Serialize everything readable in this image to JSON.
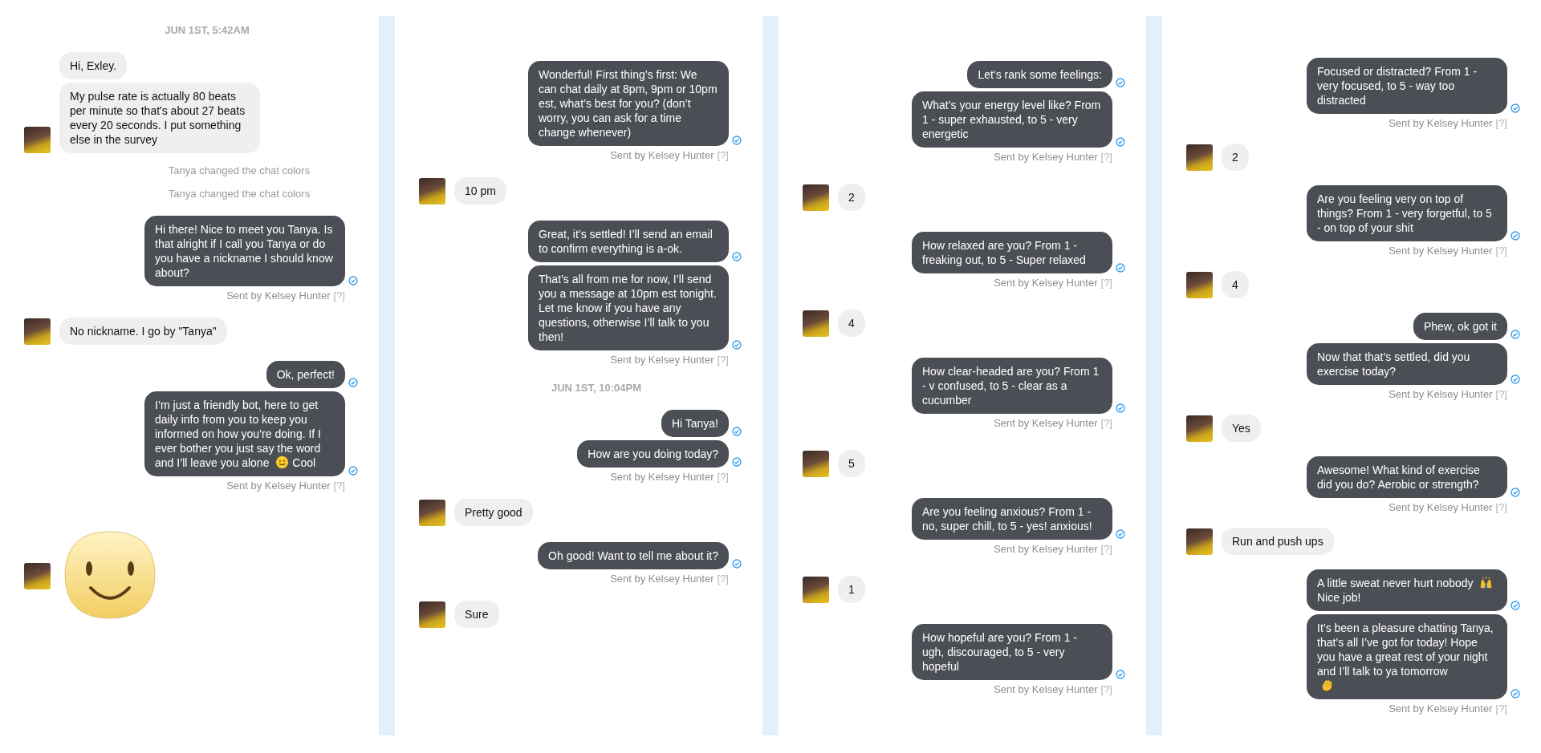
{
  "columns": [
    {
      "items": [
        {
          "kind": "timestamp",
          "text": "JUN 1ST, 5:42AM"
        },
        {
          "kind": "incoming",
          "messages": [
            {
              "text": "Hi, Exley."
            },
            {
              "text": "My pulse rate is actually 80 beats per minute so that's about 27 beats every 20 seconds. I put something else in the survey"
            }
          ]
        },
        {
          "kind": "notice",
          "text": "Tanya changed the chat colors"
        },
        {
          "kind": "notice",
          "text": "Tanya changed the chat colors"
        },
        {
          "kind": "outgoing",
          "messages": [
            {
              "text": "Hi there! Nice to meet you Tanya. Is that alright if I call you Tanya or do you have a nickname I should know about?"
            }
          ],
          "sent_by": "Sent by Kelsey Hunter",
          "help": "[?]"
        },
        {
          "kind": "incoming",
          "messages": [
            {
              "text": "No nickname.   I go by \"Tanya\""
            }
          ]
        },
        {
          "kind": "outgoing",
          "messages": [
            {
              "text": "Ok, perfect!"
            },
            {
              "segments": [
                {
                  "kind": "text",
                  "text": "I’m just a friendly bot, here to get daily info from you to keep you informed on how you’re doing. If I ever bother you just say the word"
                },
                {
                  "kind": "text",
                  "text": "and I’ll leave you alone"
                },
                {
                  "kind": "smiley"
                },
                {
                  "kind": "text",
                  "text": "Cool"
                }
              ]
            }
          ],
          "sent_by": "Sent by Kelsey Hunter",
          "help": "[?]"
        },
        {
          "kind": "sticker"
        }
      ]
    },
    {
      "items": [
        {
          "kind": "outgoing",
          "messages": [
            {
              "text": "Wonderful! First thing’s first: We can chat daily at 8pm, 9pm or 10pm est, what’s best for you? (don’t worry, you can ask for a time change whenever)"
            }
          ],
          "sent_by": "Sent by Kelsey Hunter",
          "help": "[?]"
        },
        {
          "kind": "incoming",
          "messages": [
            {
              "text": "10 pm"
            }
          ]
        },
        {
          "kind": "outgoing",
          "messages": [
            {
              "text": "Great, it’s settled! I’ll send an email to confirm everything is a-ok."
            },
            {
              "text": "That’s all from me for now, I’ll send you a message at 10pm est tonight. Let me know if you have any questions, otherwise I’ll talk to you then!"
            }
          ],
          "sent_by": "Sent by Kelsey Hunter",
          "help": "[?]"
        },
        {
          "kind": "timestamp",
          "text": "JUN 1ST, 10:04PM"
        },
        {
          "kind": "outgoing",
          "messages": [
            {
              "text": "Hi Tanya!"
            },
            {
              "text": "How are you doing today?"
            }
          ],
          "sent_by": "Sent by Kelsey Hunter",
          "help": "[?]"
        },
        {
          "kind": "incoming",
          "messages": [
            {
              "text": "Pretty good"
            }
          ]
        },
        {
          "kind": "outgoing",
          "messages": [
            {
              "text": "Oh good! Want to tell me about it?"
            }
          ],
          "sent_by": "Sent by Kelsey Hunter",
          "help": "[?]"
        },
        {
          "kind": "incoming",
          "messages": [
            {
              "text": "Sure"
            }
          ]
        }
      ]
    },
    {
      "items": [
        {
          "kind": "outgoing",
          "messages": [
            {
              "text": "Let’s rank some feelings:"
            },
            {
              "text": "What’s your energy level like? From 1 - super exhausted, to 5 - very energetic"
            }
          ],
          "sent_by": "Sent by Kelsey Hunter",
          "help": "[?]"
        },
        {
          "kind": "incoming",
          "messages": [
            {
              "text": "2"
            }
          ]
        },
        {
          "kind": "outgoing",
          "messages": [
            {
              "text": "How relaxed are you? From 1 - freaking out, to 5 - Super relaxed"
            }
          ],
          "sent_by": "Sent by Kelsey Hunter",
          "help": "[?]"
        },
        {
          "kind": "incoming",
          "messages": [
            {
              "text": "4"
            }
          ]
        },
        {
          "kind": "outgoing",
          "messages": [
            {
              "text": "How clear-headed are you? From 1 - v confused, to 5 - clear as a cucumber"
            }
          ],
          "sent_by": "Sent by Kelsey Hunter",
          "help": "[?]"
        },
        {
          "kind": "incoming",
          "messages": [
            {
              "text": "5"
            }
          ]
        },
        {
          "kind": "outgoing",
          "messages": [
            {
              "text": "Are you feeling anxious? From 1 - no, super chill, to 5 - yes! anxious!"
            }
          ],
          "sent_by": "Sent by Kelsey Hunter",
          "help": "[?]"
        },
        {
          "kind": "incoming",
          "messages": [
            {
              "text": "1"
            }
          ]
        },
        {
          "kind": "outgoing",
          "messages": [
            {
              "text": "How hopeful are you? From 1 - ugh, discouraged, to 5 - very hopeful"
            }
          ],
          "sent_by": "Sent by Kelsey Hunter",
          "help": "[?]"
        }
      ]
    },
    {
      "items": [
        {
          "kind": "outgoing",
          "messages": [
            {
              "text": "Focused or distracted? From 1 - very focused, to 5 - way too distracted"
            }
          ],
          "sent_by": "Sent by Kelsey Hunter",
          "help": "[?]"
        },
        {
          "kind": "incoming",
          "messages": [
            {
              "text": "2"
            }
          ]
        },
        {
          "kind": "outgoing",
          "messages": [
            {
              "text": "Are you feeling very on top of things? From 1 - very forgetful, to 5 - on top of your shit"
            }
          ],
          "sent_by": "Sent by Kelsey Hunter",
          "help": "[?]"
        },
        {
          "kind": "incoming",
          "messages": [
            {
              "text": "4"
            }
          ]
        },
        {
          "kind": "outgoing",
          "messages": [
            {
              "text": "Phew, ok got it"
            },
            {
              "text": "Now that that’s settled, did you exercise today?"
            }
          ],
          "sent_by": "Sent by Kelsey Hunter",
          "help": "[?]"
        },
        {
          "kind": "incoming",
          "messages": [
            {
              "text": "Yes"
            }
          ]
        },
        {
          "kind": "outgoing",
          "messages": [
            {
              "text": "Awesome! What kind of exercise did you do? Aerobic or strength?"
            }
          ],
          "sent_by": "Sent by Kelsey Hunter",
          "help": "[?]"
        },
        {
          "kind": "incoming",
          "messages": [
            {
              "text": "Run and push ups"
            }
          ]
        },
        {
          "kind": "outgoing",
          "messages": [
            {
              "segments": [
                {
                  "kind": "text",
                  "text": "A little sweat never hurt nobody"
                },
                {
                  "kind": "raised-hands"
                },
                {
                  "kind": "text",
                  "text": "Nice job!"
                }
              ]
            },
            {
              "segments": [
                {
                  "kind": "text",
                  "text": "It’s been a pleasure chatting Tanya, that’s all I’ve got for today! Hope you have a great rest of your night and I’ll talk to ya tomorrow"
                },
                {
                  "kind": "clap"
                }
              ]
            }
          ],
          "sent_by": "Sent by Kelsey Hunter",
          "help": "[?]"
        }
      ]
    }
  ]
}
